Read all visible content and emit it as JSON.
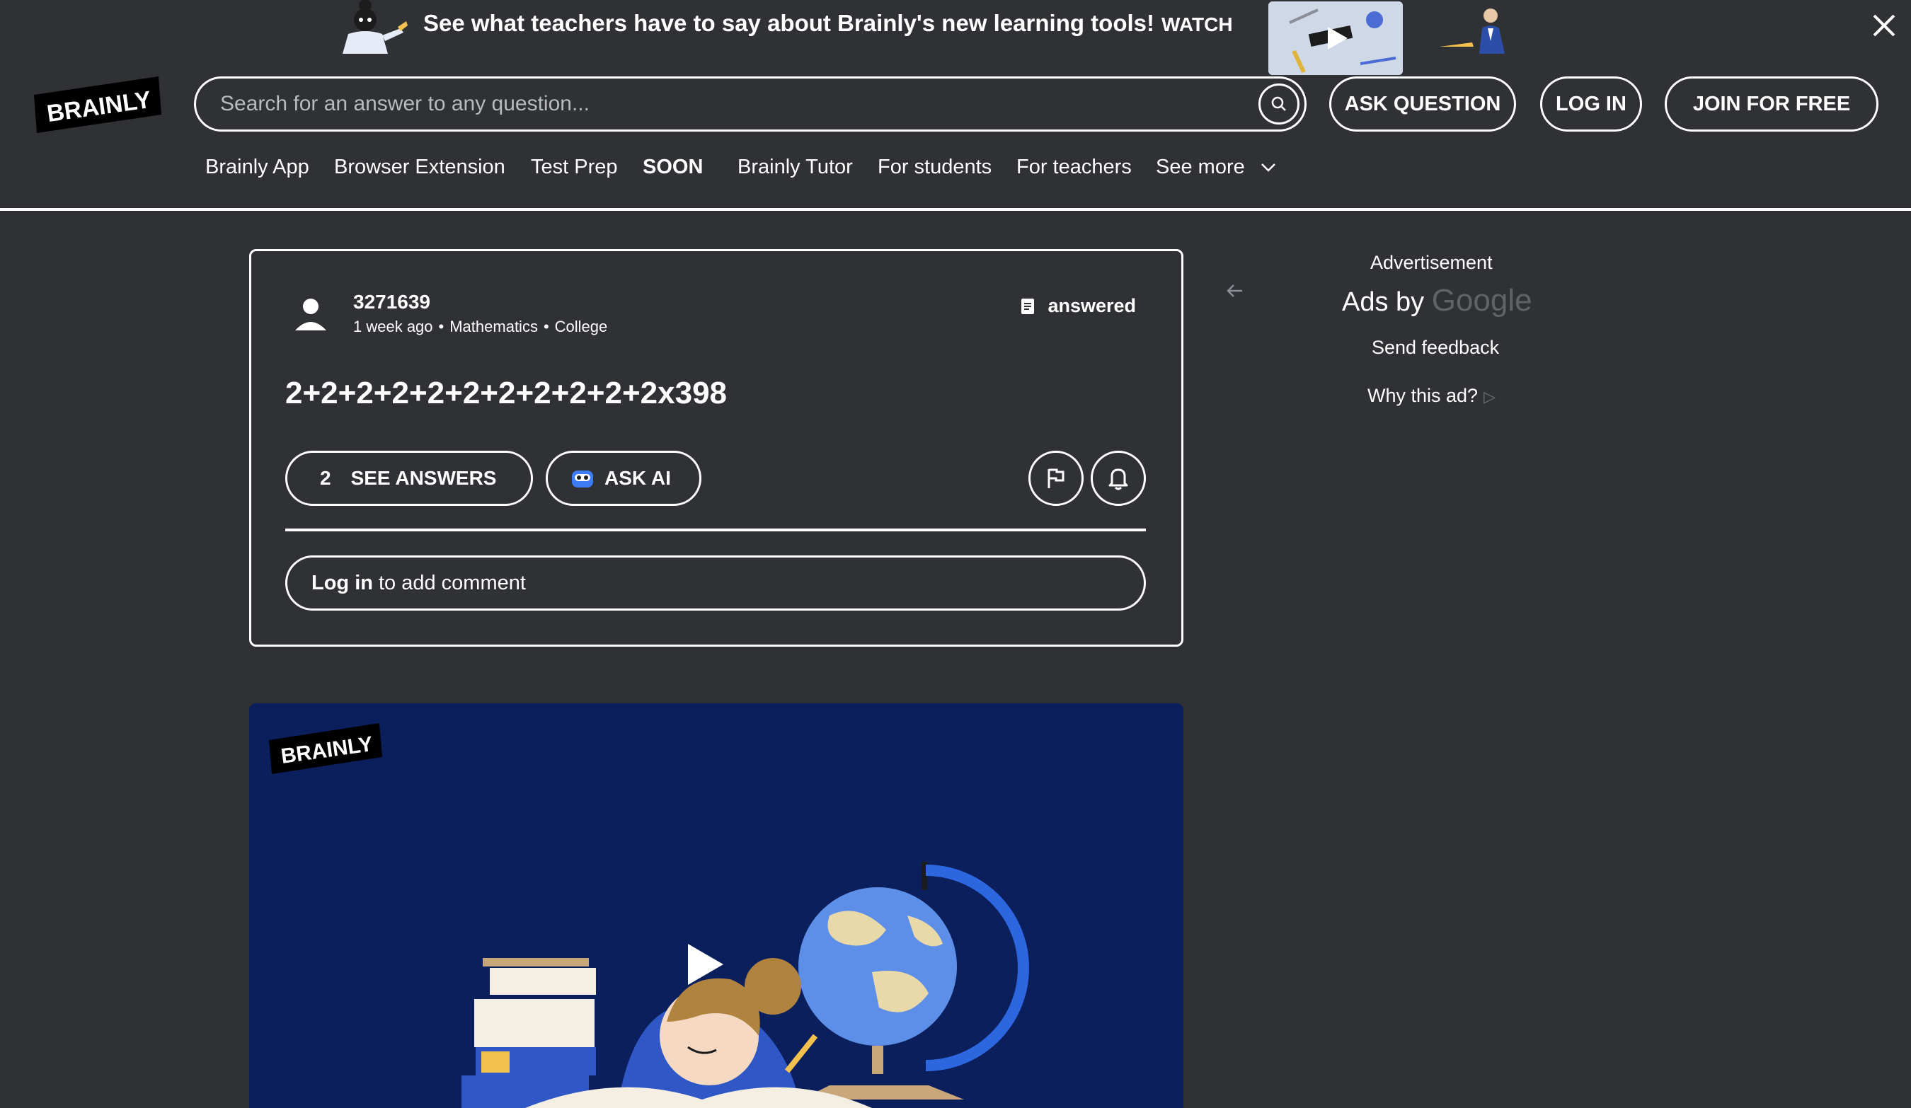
{
  "banner": {
    "text": "See what teachers have to say about Brainly's new learning tools!",
    "watch_label": "WATCH"
  },
  "header": {
    "logo_text": "BRAINLY",
    "search_placeholder": "Search for an answer to any question...",
    "ask_question_label": "ASK QUESTION",
    "login_label": "LOG IN",
    "join_label": "JOIN FOR FREE"
  },
  "nav": {
    "items": [
      "Brainly App",
      "Browser Extension",
      "Test Prep",
      "SOON",
      "Brainly Tutor",
      "For students",
      "For teachers",
      "See more"
    ]
  },
  "question": {
    "author": "3271639",
    "time": "1 week ago",
    "subject": "Mathematics",
    "level": "College",
    "status": "answered",
    "text": "2+2+2+2+2+2+2+2+2+2+2x398",
    "answers_count": "2",
    "see_answers_label": "SEE ANSWERS",
    "ask_ai_label": "ASK AI",
    "comment_login": "Log in",
    "comment_rest": "to add comment"
  },
  "ad": {
    "label": "Advertisement",
    "ads_by": "Ads by",
    "google": "Google",
    "send_feedback": "Send feedback",
    "why_ad": "Why this ad?"
  },
  "video": {
    "logo_text": "BRAINLY"
  },
  "colors": {
    "background": "#303134",
    "foreground": "#ffffff",
    "video_bg": "#0a1f5c"
  }
}
